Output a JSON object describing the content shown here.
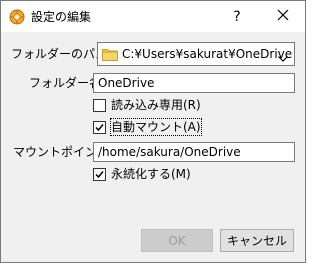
{
  "window": {
    "title": "設定の編集",
    "help_label": "?",
    "close_label": "✕"
  },
  "form": {
    "folder_path_label": "フォルダーのパス:",
    "folder_path_value": "C:¥Users¥sakurat¥OneDrive",
    "folder_name_label": "フォルダー名:",
    "folder_name_value": "OneDrive",
    "readonly_label": "読み込み専用(R)",
    "readonly_checked": false,
    "automount_label": "自動マウント(A)",
    "automount_checked": true,
    "mountpoint_label": "マウントポイント:",
    "mountpoint_value": "/home/sakura/OneDrive",
    "permanent_label": "永続化する(M)",
    "permanent_checked": true
  },
  "buttons": {
    "ok_label": "OK",
    "cancel_label": "キャンセル"
  },
  "colors": {
    "dialog_bg": "#f0f0f0",
    "folder_icon": "#f2c94c"
  }
}
